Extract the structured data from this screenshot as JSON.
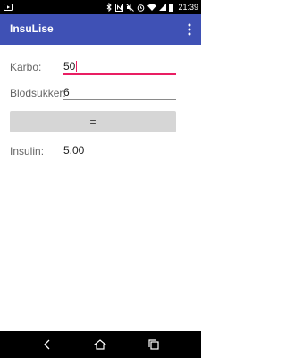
{
  "status_bar": {
    "time": "21:39",
    "icons": [
      "video-icon",
      "bluetooth-icon",
      "nfc-icon",
      "mute-icon",
      "alarm-icon",
      "wifi-icon",
      "signal-icon",
      "battery-icon"
    ]
  },
  "app_bar": {
    "title": "InsuLise",
    "menu_icon": "overflow-menu-icon"
  },
  "form": {
    "karbo": {
      "label": "Karbo:",
      "value": "50"
    },
    "blodsukker": {
      "label": "Blodsukker:",
      "value": "6"
    },
    "calculate_button": {
      "label": "="
    },
    "insulin": {
      "label": "Insulin:",
      "value": "5.00"
    }
  },
  "nav_bar": {
    "icons": [
      "back-icon",
      "home-icon",
      "recents-icon"
    ]
  },
  "colors": {
    "app_bar": "#3f51b5",
    "accent": "#e91e63",
    "button": "#d6d6d6"
  }
}
